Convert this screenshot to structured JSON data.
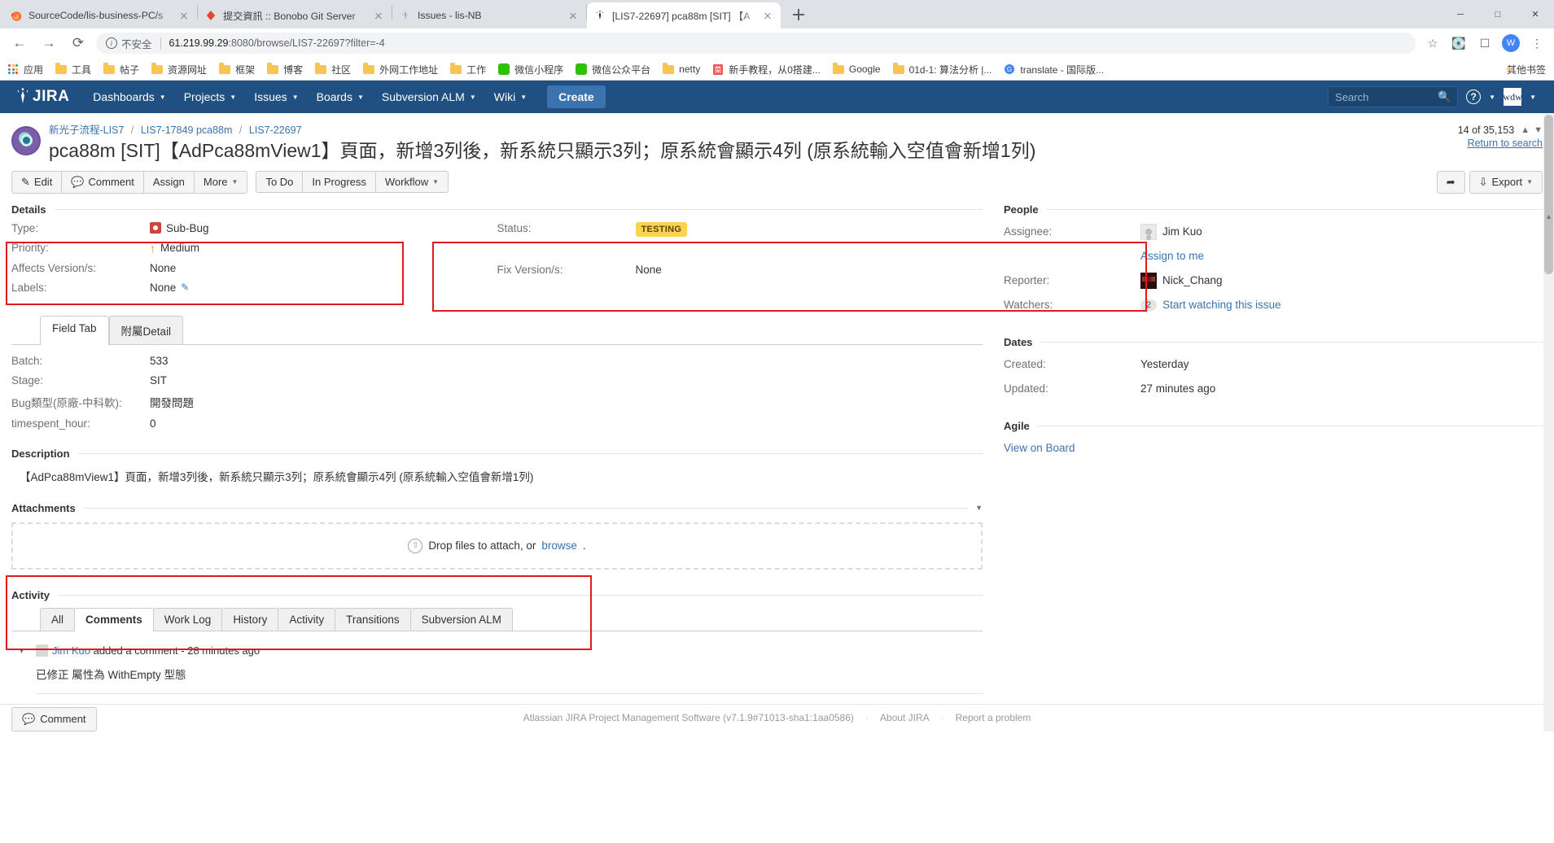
{
  "browser": {
    "tabs": [
      {
        "title": "SourceCode/lis-business-PC/s",
        "icon": "firefox-icon",
        "active": false
      },
      {
        "title": "提交資訊 :: Bonobo Git Server",
        "icon": "bonobo-icon",
        "active": false
      },
      {
        "title": "Issues - lis-NB",
        "icon": "jira-icon",
        "active": false
      },
      {
        "title": "[LIS7-22697] pca88m [SIT] 【A",
        "icon": "jira-icon",
        "active": true
      }
    ],
    "new_tab_label": "+",
    "window_controls": [
      "minimize",
      "maximize",
      "close"
    ],
    "nav": {
      "back": "←",
      "forward": "→",
      "reload": "⟳"
    },
    "url": {
      "security_label": "不安全",
      "host": "61.219.99.29",
      "rest": ":8080/browse/LIS7-22697?filter=-4",
      "full": "61.219.99.29:8080/browse/LIS7-22697?filter=-4"
    },
    "omnibox_icons": [
      "star-icon",
      "extension-icon",
      "cast-icon",
      "profile-avatar",
      "more-menu-icon"
    ],
    "profile_initial": "W",
    "bookmarks": [
      {
        "label": "应用",
        "icon": "apps-grid-icon"
      },
      {
        "label": "工具",
        "icon": "folder-icon"
      },
      {
        "label": "帖子",
        "icon": "folder-icon"
      },
      {
        "label": "资源网址",
        "icon": "folder-icon"
      },
      {
        "label": "框架",
        "icon": "folder-icon"
      },
      {
        "label": "博客",
        "icon": "folder-icon"
      },
      {
        "label": "社区",
        "icon": "folder-icon"
      },
      {
        "label": "外网工作地址",
        "icon": "folder-icon"
      },
      {
        "label": "工作",
        "icon": "folder-icon"
      },
      {
        "label": "微信小程序",
        "icon": "wechat-icon"
      },
      {
        "label": "微信公众平台",
        "icon": "wechat-icon"
      },
      {
        "label": "netty",
        "icon": "folder-icon"
      },
      {
        "label": "新手教程，从0搭建...",
        "icon": "page-icon"
      },
      {
        "label": "Google",
        "icon": "folder-icon"
      },
      {
        "label": "01d-1: 算法分析 |...",
        "icon": "folder-icon"
      },
      {
        "label": "translate - 国际版...",
        "icon": "page-icon"
      }
    ],
    "other_bookmarks": "其他书签"
  },
  "jira_nav": {
    "logo": "JIRA",
    "items": [
      {
        "label": "Dashboards",
        "caret": true
      },
      {
        "label": "Projects",
        "caret": true
      },
      {
        "label": "Issues",
        "caret": true
      },
      {
        "label": "Boards",
        "caret": true
      },
      {
        "label": "Subversion ALM",
        "caret": true
      },
      {
        "label": "Wiki",
        "caret": true
      }
    ],
    "create_label": "Create",
    "search_placeholder": "Search",
    "help_icon": "?",
    "profile_initials": "wdw"
  },
  "header": {
    "breadcrumb": [
      {
        "label": "新光子流程-LIS7"
      },
      {
        "label": "LIS7-17849 pca88m"
      },
      {
        "label": "LIS7-22697"
      }
    ],
    "breadcrumb_separator": "/",
    "title": "pca88m [SIT]【AdPca88mView1】頁面，新增3列後，新系統只顯示3列；原系統會顯示4列 (原系統輸入空值會新增1列)",
    "pager_text": "14 of 35,153",
    "return_to_search": "Return to search"
  },
  "ops_bar": {
    "group1": [
      {
        "label": "Edit",
        "icon": "pencil-icon"
      },
      {
        "label": "Comment",
        "icon": "comment-bubble-icon"
      },
      {
        "label": "Assign",
        "icon": null
      },
      {
        "label": "More",
        "icon": null,
        "caret": true
      }
    ],
    "group2": [
      {
        "label": "To Do"
      },
      {
        "label": "In Progress"
      },
      {
        "label": "Workflow",
        "caret": true
      }
    ],
    "share_icon": "share-icon",
    "export_label": "Export",
    "export_icon": "export-icon"
  },
  "details": {
    "section_title": "Details",
    "left_fields": [
      {
        "label": "Type:",
        "value": "Sub-Bug",
        "icon": "sub-bug-icon"
      },
      {
        "label": "Priority:",
        "value": "Medium",
        "icon": "priority-medium-icon"
      },
      {
        "label": "Affects Version/s:",
        "value": "None",
        "icon": null
      },
      {
        "label": "Labels:",
        "value": "None",
        "icon": "edit-pencil-icon"
      }
    ],
    "right_fields": [
      {
        "label": "Status:",
        "value": "TESTING",
        "is_status": true
      },
      {
        "label": "",
        "value": "",
        "is_status": false
      },
      {
        "label": "Fix Version/s:",
        "value": "None",
        "is_status": false
      }
    ],
    "status_color": "#ffd351"
  },
  "field_tabs": {
    "tabs": [
      {
        "label": "Field Tab",
        "active": true
      },
      {
        "label": "附屬Detail",
        "active": false
      }
    ],
    "fields": [
      {
        "label": "Batch:",
        "value": "533"
      },
      {
        "label": "Stage:",
        "value": "SIT"
      },
      {
        "label": "Bug類型(原廠-中科軟):",
        "value": "開發問題"
      },
      {
        "label": "timespent_hour:",
        "value": "0"
      }
    ]
  },
  "description": {
    "section_title": "Description",
    "text": "【AdPca88mView1】頁面，新增3列後，新系統只顯示3列；原系統會顯示4列 (原系統輸入空值會新增1列)"
  },
  "attachments": {
    "section_title": "Attachments",
    "collapse_icon": "chevron-down-icon",
    "drop_text": "Drop files to attach, or",
    "browse_label": "browse",
    "drop_suffix": ".",
    "upload_icon": "upload-cloud-icon"
  },
  "activity": {
    "section_title": "Activity",
    "tabs": [
      {
        "label": "All",
        "active": false
      },
      {
        "label": "Comments",
        "active": true
      },
      {
        "label": "Work Log",
        "active": false
      },
      {
        "label": "History",
        "active": false
      },
      {
        "label": "Activity",
        "active": false
      },
      {
        "label": "Transitions",
        "active": false
      },
      {
        "label": "Subversion ALM",
        "active": false
      }
    ],
    "comments": [
      {
        "author": "Jim Kuo",
        "action": "added a comment -",
        "time": "28 minutes ago",
        "body": "已修正 屬性為 WithEmpty 型態"
      }
    ],
    "comment_button": "Comment",
    "comment_button_icon": "comment-bubble-icon"
  },
  "people": {
    "section_title": "People",
    "assignee_label": "Assignee:",
    "assignee_value": "Jim Kuo",
    "assign_to_me": "Assign to me",
    "reporter_label": "Reporter:",
    "reporter_value": "Nick_Chang",
    "watchers_label": "Watchers:",
    "watchers_count": "2",
    "watch_link": "Start watching this issue"
  },
  "dates": {
    "section_title": "Dates",
    "created_label": "Created:",
    "created_value": "Yesterday",
    "updated_label": "Updated:",
    "updated_value": "27 minutes ago"
  },
  "agile": {
    "section_title": "Agile",
    "view_on_board": "View on Board"
  },
  "footer": {
    "text": "Atlassian JIRA Project Management Software (v7.1.9#71013-sha1:1aa0586)",
    "about": "About JIRA",
    "report": "Report a problem",
    "dot": "·"
  },
  "colors": {
    "jira_nav_bg": "#205081",
    "create_btn": "#3b73af",
    "link": "#3b73af",
    "status_testing": "#ffd351",
    "annotation_red": "#e01b1b",
    "sub_bug_red": "#d04437",
    "priority_orange": "#e8912d"
  }
}
